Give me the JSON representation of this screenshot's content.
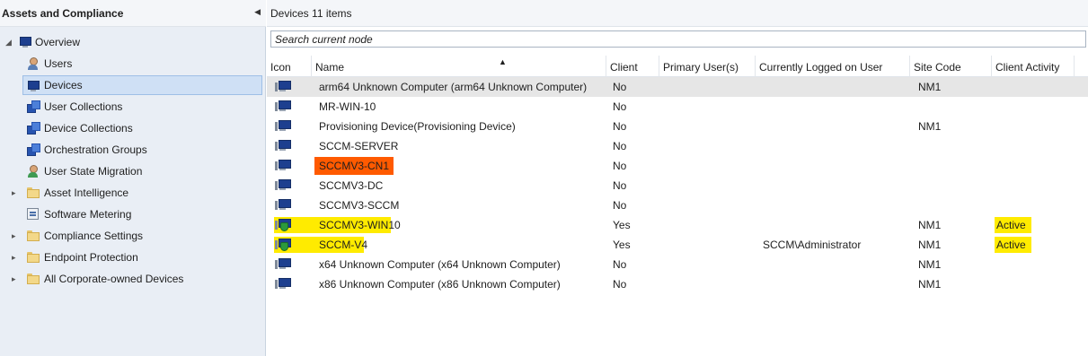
{
  "nav": {
    "title": "Assets and Compliance",
    "items": [
      {
        "label": "Overview",
        "icon": "overview-icon"
      },
      {
        "label": "Users",
        "icon": "user-icon"
      },
      {
        "label": "Devices",
        "icon": "device-icon"
      },
      {
        "label": "User Collections",
        "icon": "user-collections-icon"
      },
      {
        "label": "Device Collections",
        "icon": "device-collections-icon"
      },
      {
        "label": "Orchestration Groups",
        "icon": "orchestration-groups-icon"
      },
      {
        "label": "User State Migration",
        "icon": "user-state-migration-icon"
      },
      {
        "label": "Asset Intelligence",
        "icon": "folder-icon"
      },
      {
        "label": "Software Metering",
        "icon": "software-metering-icon"
      },
      {
        "label": "Compliance Settings",
        "icon": "folder-icon"
      },
      {
        "label": "Endpoint Protection",
        "icon": "folder-icon"
      },
      {
        "label": "All Corporate-owned Devices",
        "icon": "folder-icon"
      }
    ]
  },
  "main": {
    "title": "Devices",
    "count": "11 items",
    "search_placeholder": "Search current node",
    "columns": [
      "Icon",
      "Name",
      "Client",
      "Primary User(s)",
      "Currently Logged on User",
      "Site Code",
      "Client Activity"
    ],
    "rows": [
      {
        "name": "arm64 Unknown Computer (arm64 Unknown Computer)",
        "client": "No",
        "primary": "",
        "logged": "",
        "site": "NM1",
        "activity": ""
      },
      {
        "name": "MR-WIN-10",
        "client": "No",
        "primary": "",
        "logged": "",
        "site": "",
        "activity": ""
      },
      {
        "name": "Provisioning Device(Provisioning Device)",
        "client": "No",
        "primary": "",
        "logged": "",
        "site": "NM1",
        "activity": ""
      },
      {
        "name": "SCCM-SERVER",
        "client": "No",
        "primary": "",
        "logged": "",
        "site": "",
        "activity": ""
      },
      {
        "name": "SCCMV3-CN1",
        "client": "No",
        "primary": "",
        "logged": "",
        "site": "",
        "activity": ""
      },
      {
        "name": "SCCMV3-DC",
        "client": "No",
        "primary": "",
        "logged": "",
        "site": "",
        "activity": ""
      },
      {
        "name": "SCCMV3-SCCM",
        "client": "No",
        "primary": "",
        "logged": "",
        "site": "",
        "activity": ""
      },
      {
        "name": "SCCMV3-WIN10",
        "client": "Yes",
        "primary": "",
        "logged": "",
        "site": "NM1",
        "activity": "Active"
      },
      {
        "name": "SCCM-V4",
        "client": "Yes",
        "primary": "",
        "logged": "SCCM\\Administrator",
        "site": "NM1",
        "activity": "Active"
      },
      {
        "name": "x64 Unknown Computer (x64 Unknown Computer)",
        "client": "No",
        "primary": "",
        "logged": "",
        "site": "NM1",
        "activity": ""
      },
      {
        "name": "x86 Unknown Computer (x86 Unknown Computer)",
        "client": "No",
        "primary": "",
        "logged": "",
        "site": "NM1",
        "activity": ""
      }
    ]
  },
  "colors": {
    "nav_bg": "#e9eef5",
    "selected_bg": "#cfe0f5",
    "highlight_yellow": "#ffeb00",
    "highlight_orange": "#ff5a00"
  }
}
